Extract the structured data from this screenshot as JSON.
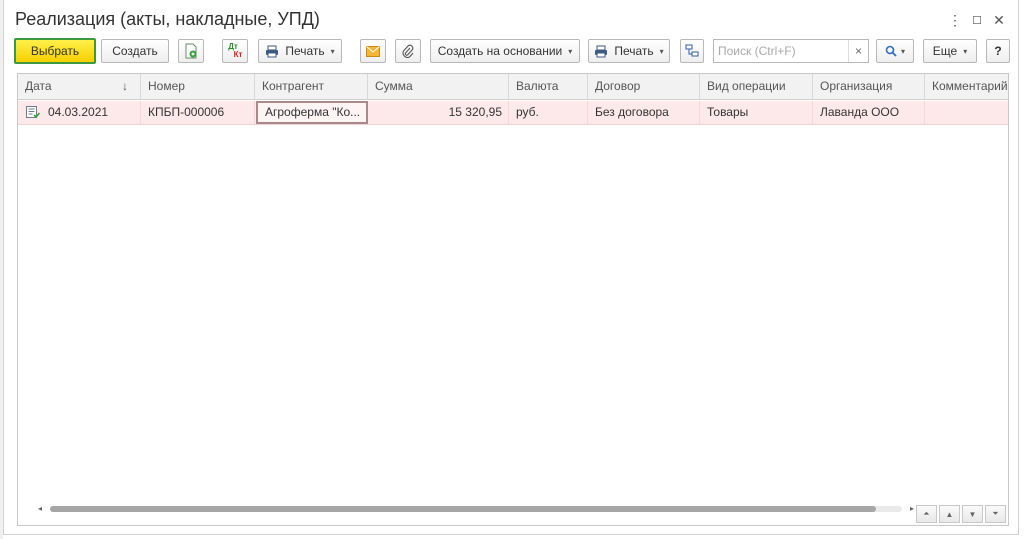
{
  "window": {
    "title": "Реализация (акты, накладные, УПД)",
    "controls": {
      "menu": "⋮",
      "maximize": "☐",
      "close": "✕"
    }
  },
  "toolbar": {
    "select_label": "Выбрать",
    "create_label": "Создать",
    "print_label": "Печать",
    "dtkt_top": "Дт",
    "dtkt_bottom": "Кт",
    "create_based_label": "Создать на основании",
    "print2_label": "Печать",
    "more_label": "Еще",
    "help_label": "?",
    "dropdown_arrow": "▾"
  },
  "search": {
    "placeholder": "Поиск (Ctrl+F)",
    "clear": "×"
  },
  "table": {
    "columns": [
      "Дата",
      "Номер",
      "Контрагент",
      "Сумма",
      "Валюта",
      "Договор",
      "Вид операции",
      "Организация",
      "Комментарий"
    ],
    "sort_indicator": "↓",
    "rows": [
      {
        "date": "04.03.2021",
        "number": "КПБП-000006",
        "counterparty": "Агроферма \"Ко...",
        "amount": "15 320,95",
        "currency": "руб.",
        "contract": "Без договора",
        "operation": "Товары",
        "organization": "Лаванда ООО",
        "comment": ""
      }
    ]
  },
  "scroll": {
    "left": "◂",
    "right": "▸"
  },
  "nav": {
    "first": "⏶",
    "up": "▲",
    "down": "▼",
    "last": "⏷"
  },
  "colors": {
    "primary_button": "#f5d000",
    "primary_border": "#3c9a3c",
    "row_highlight": "#fde9e9"
  }
}
